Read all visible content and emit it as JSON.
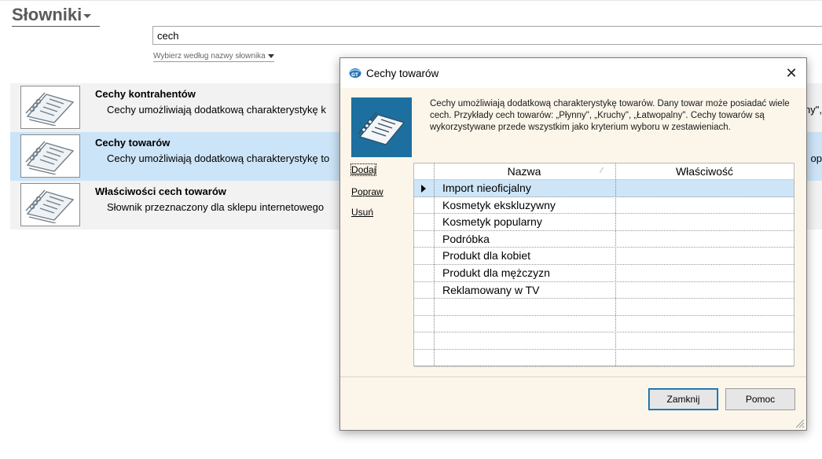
{
  "page": {
    "title": "Słowniki",
    "search_value": "cech",
    "search_mode_label": "Wybierz według nazwy słownika"
  },
  "dictionaries": [
    {
      "name": "Cechy kontrahentów",
      "description": "Cechy umożliwiają dodatkową charakterystykę k",
      "description_tail": "ny\",",
      "selected": false
    },
    {
      "name": "Cechy towarów",
      "description": "Cechy umożliwiają dodatkową charakterystykę to",
      "description_tail": "op",
      "selected": true
    },
    {
      "name": "Właściwości cech towarów",
      "description": "Słownik przeznaczony dla sklepu internetowego",
      "description_tail": "",
      "selected": false
    }
  ],
  "dialog": {
    "title": "Cechy towarów",
    "description": "Cechy umożliwiają dodatkową charakterystykę towarów. Dany towar może posiadać wiele cech. Przykłady cech towarów: „Płynny\", „Kruchy\", „Łatwopalny\". Cechy towarów są wykorzystywane przede wszystkim jako kryterium wyboru w zestawieniach.",
    "actions": [
      "Dodaj",
      "Popraw",
      "Usuń"
    ],
    "grid": {
      "columns": [
        "Nazwa",
        "Właściwość"
      ],
      "rows": [
        {
          "nazwa": "Import nieoficjalny",
          "wlasciwosc": "",
          "selected": true
        },
        {
          "nazwa": "Kosmetyk ekskluzywny",
          "wlasciwosc": "",
          "selected": false
        },
        {
          "nazwa": "Kosmetyk popularny",
          "wlasciwosc": "",
          "selected": false
        },
        {
          "nazwa": "Podróbka",
          "wlasciwosc": "",
          "selected": false
        },
        {
          "nazwa": "Produkt dla kobiet",
          "wlasciwosc": "",
          "selected": false
        },
        {
          "nazwa": "Produkt dla mężczyzn",
          "wlasciwosc": "",
          "selected": false
        },
        {
          "nazwa": "Reklamowany w TV",
          "wlasciwosc": "",
          "selected": false
        }
      ],
      "empty_rows": 4
    },
    "buttons": {
      "close": "Zamknij",
      "help": "Pomoc"
    }
  },
  "colors": {
    "selected_row": "#cce4f7",
    "dialog_bg": "#fcf6ea",
    "banner": "#1d6f9f"
  }
}
